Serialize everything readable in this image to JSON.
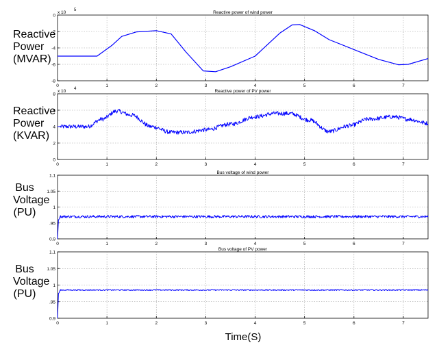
{
  "xlabel": "Time(S)",
  "chart_data": [
    {
      "type": "line",
      "title": "Reactive power of wind power",
      "ylabel_lines": [
        "Reactive",
        "Power",
        "(MVAR)"
      ],
      "exponent": "x 10",
      "exponent_power": "5",
      "xlim": [
        0,
        7.5
      ],
      "ylim": [
        -8,
        0
      ],
      "xticks": [
        "0",
        "1",
        "2",
        "3",
        "4",
        "5",
        "6",
        "7"
      ],
      "yticks": [
        "-8",
        "-6",
        "-4",
        "-2",
        "0"
      ],
      "noise": 0,
      "series": [
        {
          "color": "#0000ff",
          "x": [
            0,
            0.8,
            1.1,
            1.3,
            1.6,
            2.0,
            2.3,
            2.6,
            2.95,
            3.2,
            3.5,
            4.0,
            4.5,
            4.75,
            4.9,
            5.2,
            5.5,
            6.0,
            6.5,
            6.9,
            7.1,
            7.5
          ],
          "y": [
            -5,
            -5,
            -3.7,
            -2.6,
            -2.05,
            -1.9,
            -2.3,
            -4.5,
            -6.8,
            -6.9,
            -6.3,
            -5.0,
            -2.2,
            -1.2,
            -1.15,
            -1.9,
            -3.0,
            -4.2,
            -5.4,
            -6.05,
            -6.0,
            -5.3
          ]
        }
      ]
    },
    {
      "type": "line",
      "title": "Reactive power of PV power",
      "ylabel_lines": [
        "Reactive",
        "Power",
        "(KVAR)"
      ],
      "exponent": "x 10",
      "exponent_power": "4",
      "xlim": [
        0,
        7.5
      ],
      "ylim": [
        0,
        8
      ],
      "xticks": [
        "0",
        "1",
        "2",
        "3",
        "4",
        "5",
        "6",
        "7"
      ],
      "yticks": [
        "0",
        "2",
        "4",
        "6",
        "8"
      ],
      "noise": 0.25,
      "series": [
        {
          "color": "#0000ff",
          "x": [
            0,
            0.6,
            0.9,
            1.2,
            1.5,
            1.9,
            2.3,
            2.6,
            3.0,
            3.5,
            4.0,
            4.4,
            4.7,
            5.1,
            5.5,
            5.9,
            6.3,
            6.8,
            7.1,
            7.5
          ],
          "y": [
            4.0,
            4.0,
            4.9,
            5.9,
            5.4,
            4.0,
            3.3,
            3.3,
            3.6,
            4.3,
            5.2,
            5.6,
            5.6,
            4.8,
            3.4,
            4.1,
            4.9,
            5.2,
            4.9,
            4.4
          ]
        }
      ]
    },
    {
      "type": "line",
      "title": "Bus voltage of wind power",
      "ylabel_lines": [
        "Bus",
        "Voltage",
        "(PU)"
      ],
      "exponent": "",
      "exponent_power": "",
      "xlim": [
        0,
        7.5
      ],
      "ylim": [
        0.9,
        1.1
      ],
      "xticks": [
        "0",
        "1",
        "2",
        "3",
        "4",
        "5",
        "6",
        "7"
      ],
      "yticks": [
        "0.9",
        ".95",
        "1",
        "1.05",
        "1.1"
      ],
      "noise": 0.004,
      "series": [
        {
          "color": "#0000ff",
          "x": [
            0,
            0.02,
            0.06,
            7.5
          ],
          "y": [
            0.9,
            0.96,
            0.97,
            0.97
          ]
        }
      ]
    },
    {
      "type": "line",
      "title": "Bus voltage of PV power",
      "ylabel_lines": [
        "Bus",
        "Voltage",
        "(PU)"
      ],
      "exponent": "",
      "exponent_power": "",
      "xlim": [
        0,
        7.5
      ],
      "ylim": [
        0.9,
        1.1
      ],
      "xticks": [
        "0",
        "1",
        "2",
        "3",
        "4",
        "5",
        "6",
        "7"
      ],
      "yticks": [
        "0.9",
        ".95",
        "1",
        "1.05",
        "1.1"
      ],
      "noise": 0.0015,
      "series": [
        {
          "color": "#0000ff",
          "x": [
            0,
            0.02,
            0.06,
            7.5
          ],
          "y": [
            0.9,
            0.975,
            0.985,
            0.985
          ]
        }
      ]
    }
  ]
}
